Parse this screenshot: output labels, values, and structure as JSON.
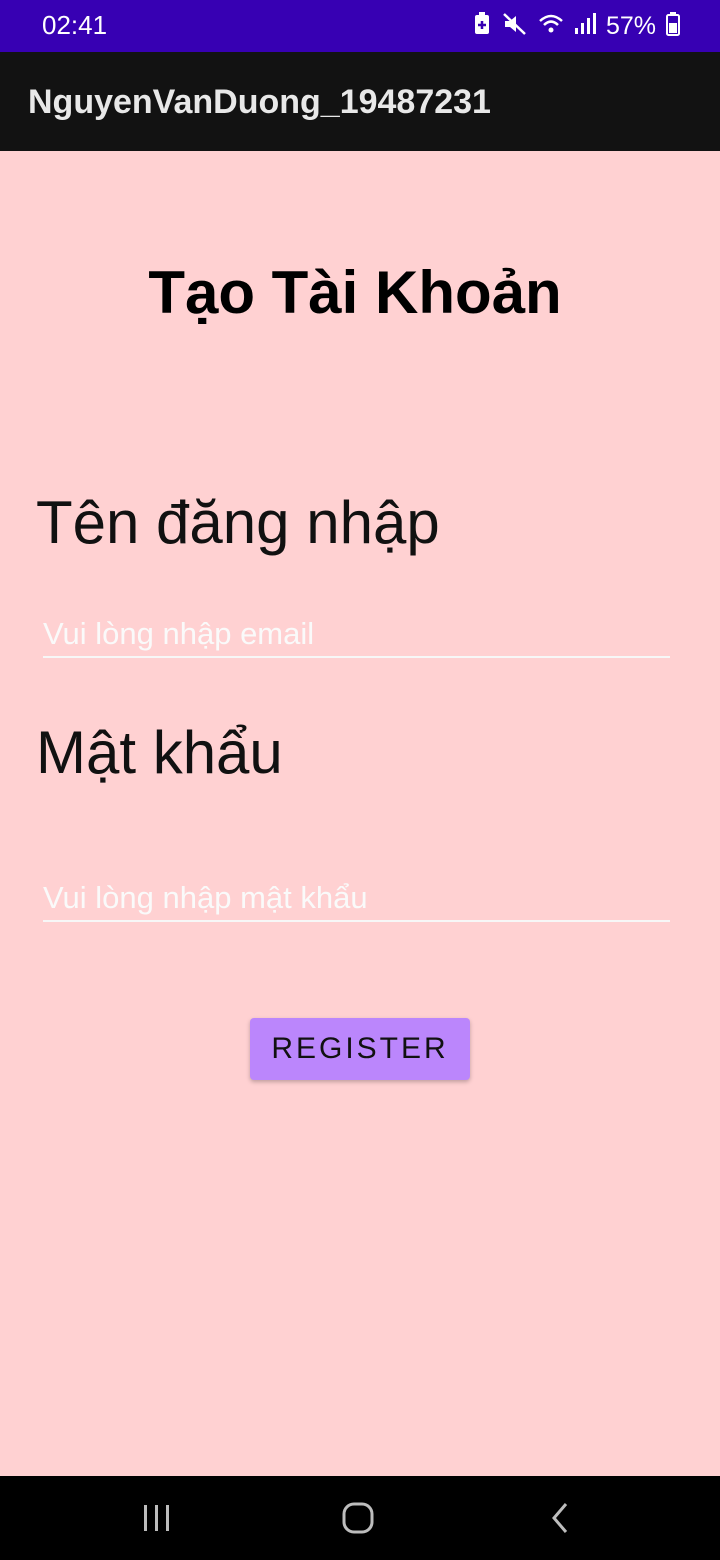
{
  "status_bar": {
    "time": "02:41",
    "battery_percent": "57%",
    "icons": [
      "battery-saver-icon",
      "mute-icon",
      "wifi-icon",
      "signal-icon",
      "battery-icon"
    ]
  },
  "app_bar": {
    "title": "NguyenVanDuong_19487231"
  },
  "form": {
    "title": "Tạo Tài Khoản",
    "username_label": "Tên đăng nhập",
    "username_placeholder": "Vui lòng nhập email",
    "username_value": "",
    "password_label": "Mật khẩu",
    "password_placeholder": "Vui lòng nhập mật khẩu",
    "password_value": "",
    "register_label": "REGISTER"
  },
  "nav_bar": {
    "buttons": [
      "recents-icon",
      "home-icon",
      "back-icon"
    ]
  },
  "colors": {
    "status_bar": "#3700B3",
    "app_bar": "#121212",
    "background": "#FFD1D2",
    "button": "#BB86FC",
    "nav_bar": "#000000"
  }
}
